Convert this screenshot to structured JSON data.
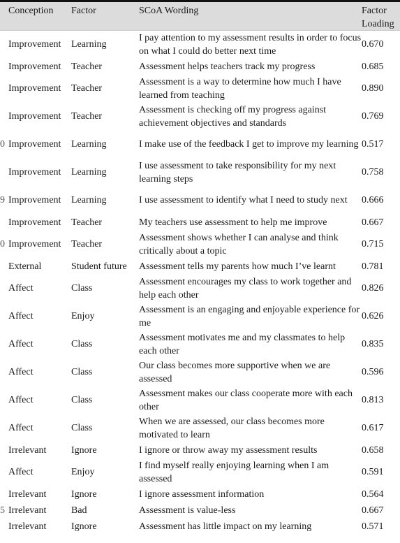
{
  "table": {
    "headers": {
      "conception": "Conception",
      "factor": "Factor",
      "wording": "SCoA Wording",
      "loading": "Factor Loading"
    },
    "rows": [
      {
        "marker": "",
        "conception": "Improvement",
        "factor": "Learning",
        "wording": "I pay attention to my assessment results in order to focus on what I could do better next time",
        "loading": "0.670",
        "lines": 2
      },
      {
        "marker": "",
        "conception": "Improvement",
        "factor": "Teacher",
        "wording": "Assessment helps teachers track my progress",
        "loading": "0.685",
        "lines": 1
      },
      {
        "marker": "",
        "conception": "Improvement",
        "factor": "Teacher",
        "wording": "Assessment is a way to determine how much I have learned from teaching",
        "loading": "0.890",
        "lines": 2
      },
      {
        "marker": "",
        "conception": "Improvement",
        "factor": "Teacher",
        "wording": "Assessment is checking off my progress against achievement objectives and standards",
        "loading": "0.769",
        "lines": 2
      },
      {
        "marker": "0",
        "conception": "Improvement",
        "factor": "Learning",
        "wording": "I make use of the feedback I get to improve my learning",
        "loading": "0.517",
        "lines": 2
      },
      {
        "marker": "",
        "conception": "Improvement",
        "factor": "Learning",
        "wording": "I use assessment to take responsibility for my next learning steps",
        "loading": "0.758",
        "lines": 2
      },
      {
        "marker": "9",
        "conception": "Improvement",
        "factor": "Learning",
        "wording": "I use assessment to identify what I need to study next",
        "loading": "0.666",
        "lines": 2
      },
      {
        "marker": "",
        "conception": "Improvement",
        "factor": "Teacher",
        "wording": "My teachers use assessment to help me improve",
        "loading": "0.667",
        "lines": 1
      },
      {
        "marker": "0",
        "conception": "Improvement",
        "factor": "Teacher",
        "wording": "Assessment shows whether I can analyse and think critically about a topic",
        "loading": "0.715",
        "lines": 2
      },
      {
        "marker": "",
        "conception": "External",
        "factor": "Student future",
        "wording": "Assessment tells my parents how much I’ve learnt",
        "loading": "0.781",
        "lines": 1
      },
      {
        "marker": "",
        "conception": "Affect",
        "factor": "Class",
        "wording": "Assessment encourages my class to work together and help each other",
        "loading": "0.826",
        "lines": 2
      },
      {
        "marker": "",
        "conception": "Affect",
        "factor": "Enjoy",
        "wording": "Assessment is an engaging and enjoyable experience for me",
        "loading": "0.626",
        "lines": 2
      },
      {
        "marker": "",
        "conception": "Affect",
        "factor": "Class",
        "wording": "Assessment motivates me and my classmates to help each other",
        "loading": "0.835",
        "lines": 2
      },
      {
        "marker": "",
        "conception": "Affect",
        "factor": "Class",
        "wording": "Our class becomes more supportive when we are assessed",
        "loading": "0.596",
        "lines": 2
      },
      {
        "marker": "",
        "conception": "Affect",
        "factor": "Class",
        "wording": "Assessment makes our class cooperate more with each other",
        "loading": "0.813",
        "lines": 2
      },
      {
        "marker": "",
        "conception": "Affect",
        "factor": "Class",
        "wording": "When we are assessed, our class becomes more motivated to learn",
        "loading": "0.617",
        "lines": 2
      },
      {
        "marker": "",
        "conception": "Irrelevant",
        "factor": "Ignore",
        "wording": "I ignore or throw away my assessment results",
        "loading": "0.658",
        "lines": 1
      },
      {
        "marker": "",
        "conception": "Affect",
        "factor": "Enjoy",
        "wording": "I find myself really enjoying learning when I am assessed",
        "loading": "0.591",
        "lines": 2
      },
      {
        "marker": "",
        "conception": "Irrelevant",
        "factor": "Ignore",
        "wording": "I ignore assessment information",
        "loading": "0.564",
        "lines": 1
      },
      {
        "marker": "5",
        "conception": "Irrelevant",
        "factor": "Bad",
        "wording": "Assessment is value-less",
        "loading": "0.667",
        "lines": 1
      },
      {
        "marker": "",
        "conception": "Irrelevant",
        "factor": "Ignore",
        "wording": "Assessment has little impact on my learning",
        "loading": "0.571",
        "lines": 1
      }
    ]
  }
}
